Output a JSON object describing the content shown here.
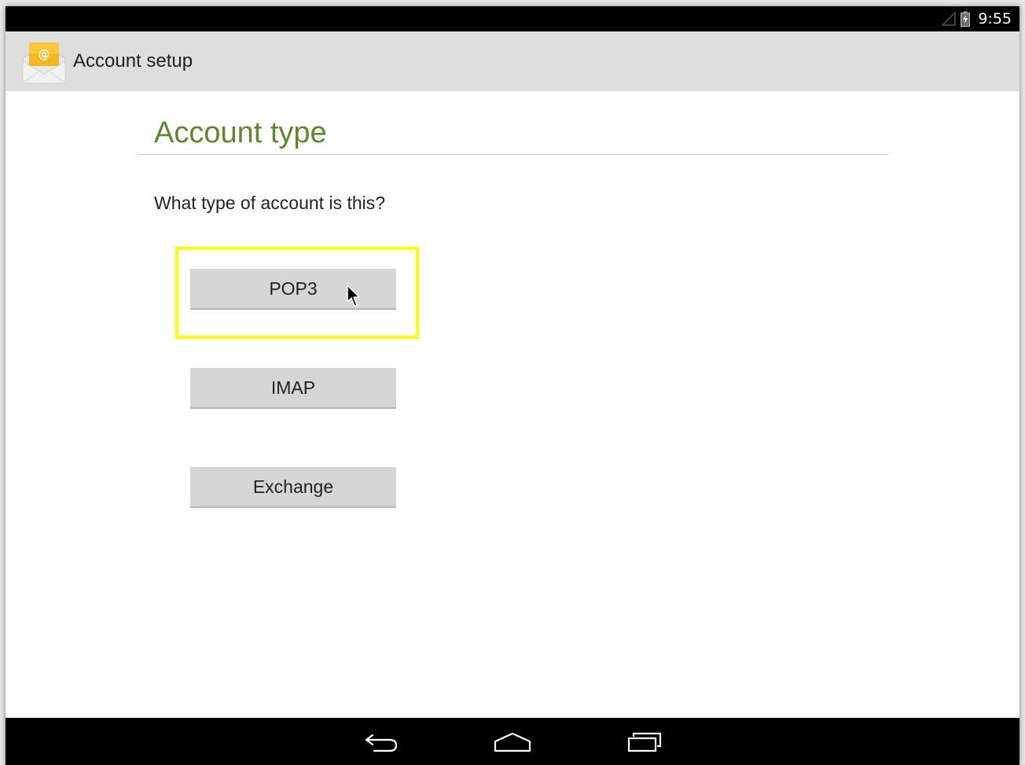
{
  "status_bar": {
    "time": "9:55",
    "icons": [
      "signal-icon",
      "battery-icon"
    ]
  },
  "action_bar": {
    "icon": "email-app-icon",
    "title": "Account setup"
  },
  "content": {
    "section_title": "Account type",
    "question": "What type of account is this?",
    "buttons": [
      {
        "label": "POP3",
        "highlighted": true
      },
      {
        "label": "IMAP",
        "highlighted": false
      },
      {
        "label": "Exchange",
        "highlighted": false
      }
    ]
  },
  "nav_bar": {
    "icons": [
      "back-icon",
      "home-icon",
      "recent-apps-icon"
    ]
  },
  "colors": {
    "accent_title": "#5b8a2c",
    "highlight": "#ffff00",
    "button_bg": "#d6d6d6",
    "action_bar_bg": "#dedede"
  }
}
